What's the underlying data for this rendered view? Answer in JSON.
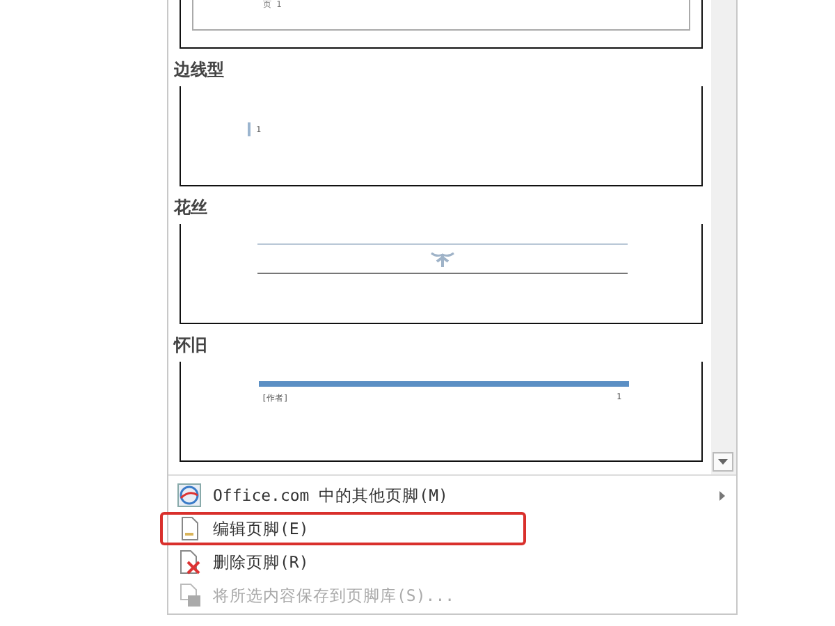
{
  "gallery": {
    "partial_card": {
      "text": "页 1"
    },
    "sections": [
      {
        "kind": "bar-number",
        "title": "边线型",
        "text": "1"
      },
      {
        "kind": "ornament",
        "title": "花丝"
      },
      {
        "kind": "retro",
        "title": "怀旧",
        "left_text": "[作者]",
        "right_text": "1"
      }
    ]
  },
  "menu": [
    {
      "kind": "web",
      "label": "Office.com 中的其他页脚(M)",
      "submenu": true,
      "disabled": false,
      "highlighted": false
    },
    {
      "kind": "edit",
      "label": "编辑页脚(E)",
      "submenu": false,
      "disabled": false,
      "highlighted": true
    },
    {
      "kind": "delete",
      "label": "删除页脚(R)",
      "submenu": false,
      "disabled": false,
      "highlighted": false
    },
    {
      "kind": "save",
      "label": "将所选内容保存到页脚库(S)...",
      "submenu": false,
      "disabled": true,
      "highlighted": false
    }
  ]
}
